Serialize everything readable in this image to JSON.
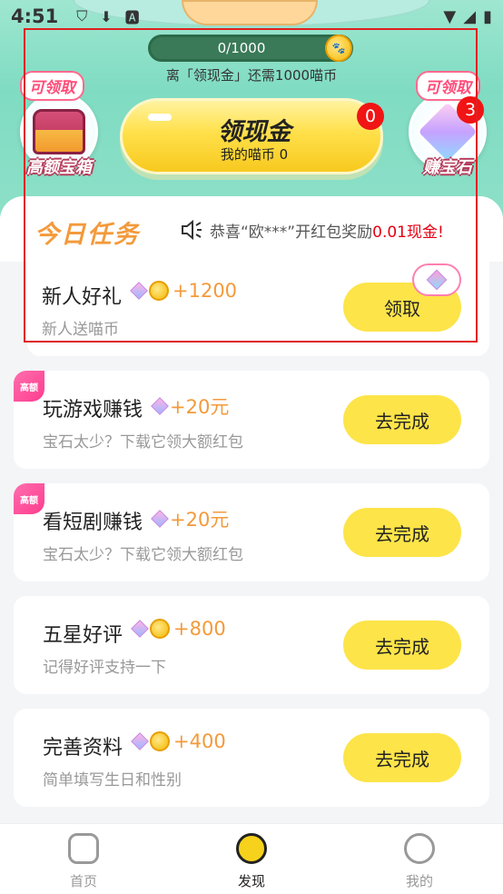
{
  "status_bar": {
    "time": "4:51"
  },
  "progress": {
    "text": "0/1000",
    "fraction": 0.0
  },
  "hint": "离「领现金」还需1000喵币",
  "treasure": {
    "bubble": "可领取",
    "label": "高额宝箱"
  },
  "gems": {
    "bubble": "可领取",
    "label": "赚宝石",
    "badge": "3"
  },
  "cash_button": {
    "title": "领现金",
    "subtitle": "我的喵币 0",
    "badge": "0"
  },
  "today": {
    "title": "今日任务",
    "marquee_prefix": "恭喜“欧***”开红包奖励",
    "marquee_highlight": "0.01现金!"
  },
  "tasks": [
    {
      "name": "新人好礼",
      "reward": "+1200",
      "desc": "新人送喵币",
      "button": "领取"
    },
    {
      "name": "玩游戏赚钱",
      "reward": "+20元",
      "desc": "宝石太少？下载它领大额红包",
      "button": "去完成",
      "tag": "高额"
    },
    {
      "name": "看短剧赚钱",
      "reward": "+20元",
      "desc": "宝石太少？下载它领大额红包",
      "button": "去完成",
      "tag": "高额"
    },
    {
      "name": "五星好评",
      "reward": "+800",
      "desc": "记得好评支持一下",
      "button": "去完成"
    },
    {
      "name": "完善资料",
      "reward": "+400",
      "desc": "简单填写生日和性别",
      "button": "去完成"
    }
  ],
  "nav": [
    {
      "label": "首页",
      "icon": "home-icon"
    },
    {
      "label": "发现",
      "icon": "compass-icon"
    },
    {
      "label": "我的",
      "icon": "profile-icon"
    }
  ]
}
